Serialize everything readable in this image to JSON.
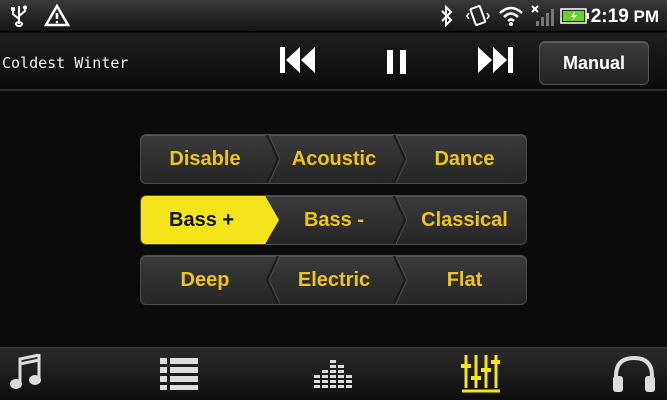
{
  "status_bar": {
    "time": "2:19",
    "ampm": "PM"
  },
  "player": {
    "song_title": "Coldest Winter",
    "mode_label": "Manual"
  },
  "presets": {
    "row1": [
      "Disable",
      "Acoustic",
      "Dance"
    ],
    "row2": [
      "Bass +",
      "Bass -",
      "Classical"
    ],
    "row3": [
      "Deep",
      "Electric",
      "Flat"
    ],
    "active": "Bass +"
  },
  "colors": {
    "accent_yellow": "#f4e51a",
    "label_yellow": "#f0c419"
  },
  "bottom_nav": {
    "icons": [
      "music-note-icon",
      "list-icon",
      "equalizer-bars-icon",
      "sliders-icon",
      "headphones-icon"
    ],
    "active": "sliders-icon"
  }
}
